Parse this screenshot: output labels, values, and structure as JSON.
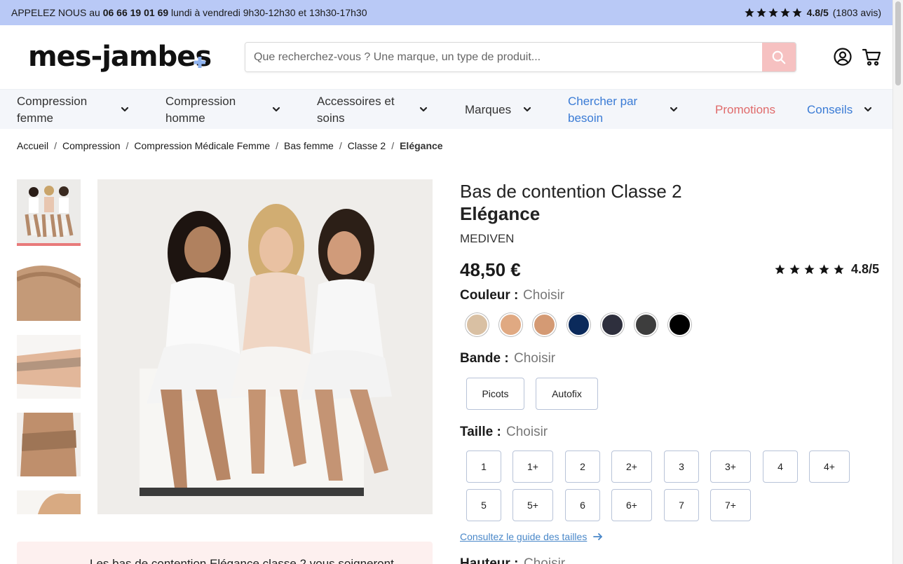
{
  "topbar": {
    "call_prefix": "APPELEZ NOUS au",
    "phone": "06 66 19 01 69",
    "hours": "lundi à vendredi 9h30-12h30 et 13h30-17h30",
    "rating": "4.8/5",
    "reviews": "(1803 avis)",
    "stars": 5
  },
  "header": {
    "logo": "mes-jambes",
    "search_placeholder": "Que recherchez-vous ? Une marque, un type de produit..."
  },
  "nav": {
    "items": [
      {
        "label": "Compression femme",
        "color": "#333333"
      },
      {
        "label": "Compression homme",
        "color": "#333333"
      },
      {
        "label": "Accessoires et soins",
        "color": "#333333"
      },
      {
        "label": "Marques",
        "color": "#333333"
      },
      {
        "label": "Chercher par besoin",
        "color": "#3a7bd5"
      },
      {
        "label": "Promotions",
        "color": "#e06a6a"
      },
      {
        "label": "Conseils",
        "color": "#3a7bd5"
      }
    ]
  },
  "breadcrumb": [
    "Accueil",
    "Compression",
    "Compression Médicale Femme",
    "Bas femme",
    "Classe 2",
    "Elégance"
  ],
  "product": {
    "title_line1": "Bas de contention Classe 2",
    "title_line2": "Elégance",
    "brand": "MEDIVEN",
    "price": "48,50 €",
    "rating": "4.8/5",
    "stars": 5,
    "color_label": "Couleur :",
    "color_value": "Choisir",
    "colors": [
      "#d9c0a3",
      "#e0a982",
      "#d49a74",
      "#0b2a5b",
      "#2e2f3d",
      "#3d3d3d",
      "#000000"
    ],
    "band_label": "Bande :",
    "band_value": "Choisir",
    "bands": [
      "Picots",
      "Autofix"
    ],
    "size_label": "Taille :",
    "size_value": "Choisir",
    "sizes": [
      "1",
      "1+",
      "2",
      "2+",
      "3",
      "3+",
      "4",
      "4+",
      "5",
      "5+",
      "6",
      "6+",
      "7",
      "7+"
    ],
    "size_guide": "Consultez le guide des tailles",
    "height_label": "Hauteur :",
    "height_value": "Choisir"
  },
  "description_teaser": "Les bas de contention Elégance classe 2 vous soigneront"
}
